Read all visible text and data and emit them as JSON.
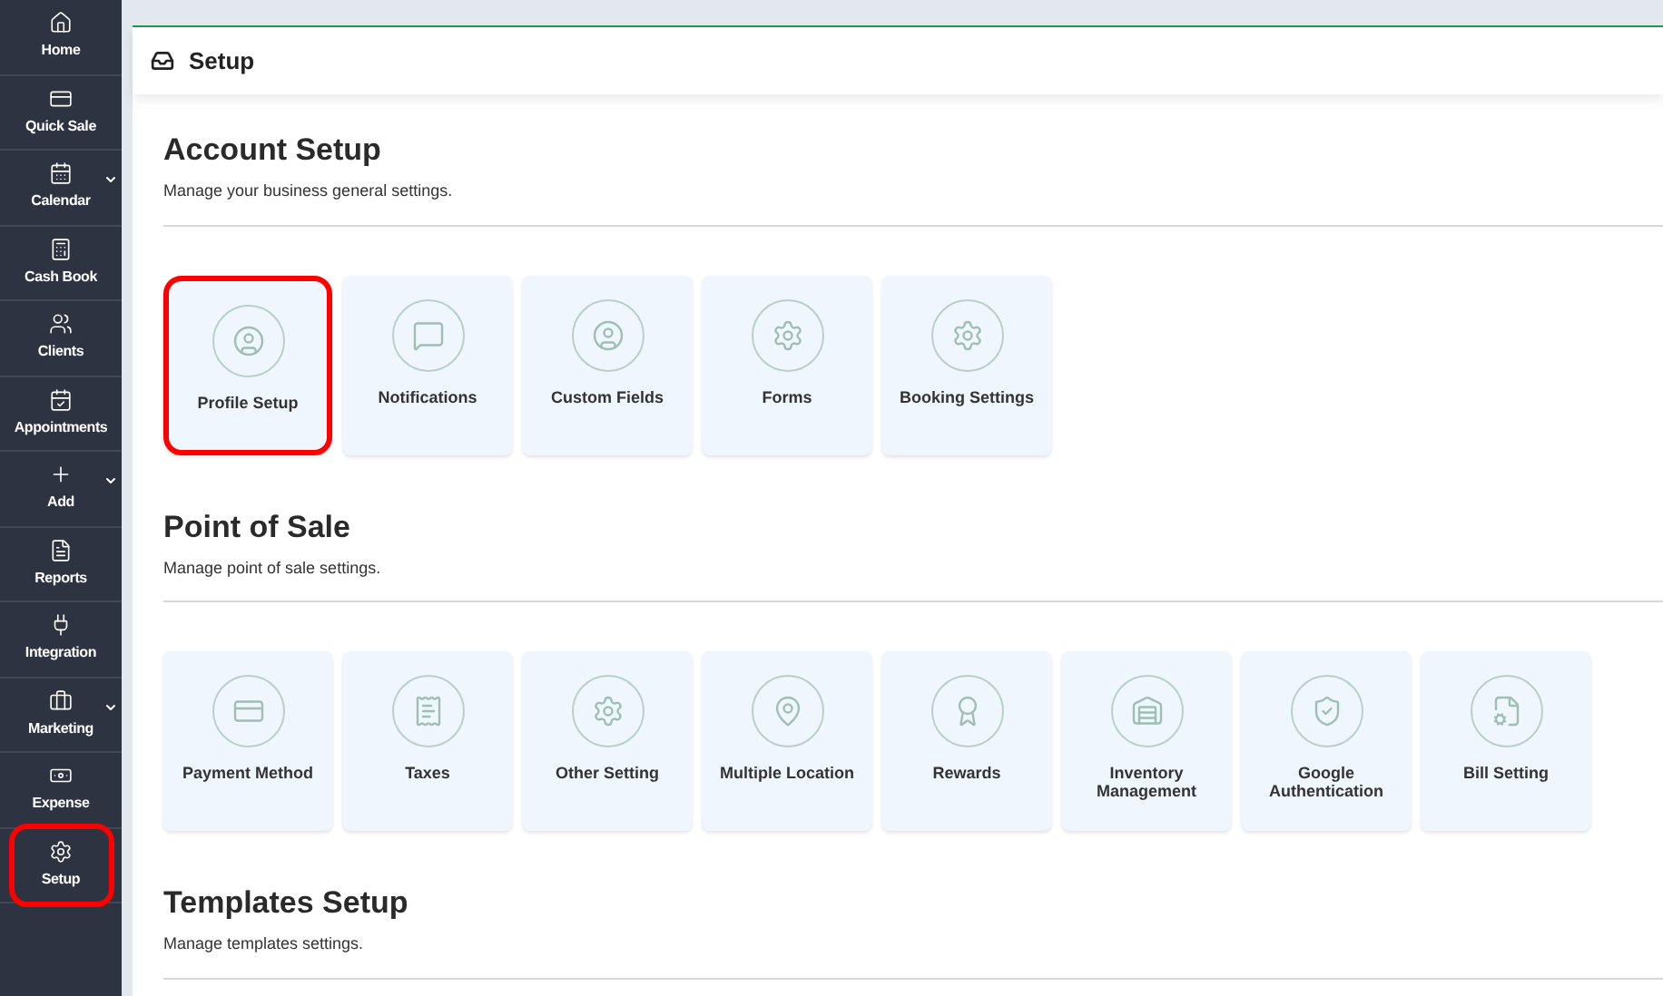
{
  "sidebar": {
    "items": [
      {
        "label": "Home",
        "selected": false,
        "expandable": false
      },
      {
        "label": "Quick Sale",
        "selected": false,
        "expandable": false
      },
      {
        "label": "Calendar",
        "selected": false,
        "expandable": true
      },
      {
        "label": "Cash Book",
        "selected": false,
        "expandable": false
      },
      {
        "label": "Clients",
        "selected": false,
        "expandable": false
      },
      {
        "label": "Appointments",
        "selected": false,
        "expandable": false
      },
      {
        "label": "Add",
        "selected": false,
        "expandable": true
      },
      {
        "label": "Reports",
        "selected": false,
        "expandable": false
      },
      {
        "label": "Integration",
        "selected": false,
        "expandable": false
      },
      {
        "label": "Marketing",
        "selected": false,
        "expandable": true
      },
      {
        "label": "Expense",
        "selected": false,
        "expandable": false
      },
      {
        "label": "Setup",
        "selected": true,
        "expandable": false
      }
    ]
  },
  "page_title": "Setup",
  "sections": [
    {
      "title": "Account Setup",
      "subtitle": "Manage your business general settings.",
      "tiles": [
        {
          "label": "Profile Setup",
          "highlighted": true
        },
        {
          "label": "Notifications",
          "highlighted": false
        },
        {
          "label": "Custom Fields",
          "highlighted": false
        },
        {
          "label": "Forms",
          "highlighted": false
        },
        {
          "label": "Booking Settings",
          "highlighted": false
        }
      ]
    },
    {
      "title": "Point of Sale",
      "subtitle": "Manage point of sale settings.",
      "tiles": [
        {
          "label": "Payment Method",
          "highlighted": false
        },
        {
          "label": "Taxes",
          "highlighted": false
        },
        {
          "label": "Other Setting",
          "highlighted": false
        },
        {
          "label": "Multiple Location",
          "highlighted": false
        },
        {
          "label": "Rewards",
          "highlighted": false
        },
        {
          "label": "Inventory Management",
          "highlighted": false
        },
        {
          "label": "Google Authentication",
          "highlighted": false
        },
        {
          "label": "Bill Setting",
          "highlighted": false
        }
      ]
    },
    {
      "title": "Templates Setup",
      "subtitle": "Manage templates settings."
    }
  ]
}
